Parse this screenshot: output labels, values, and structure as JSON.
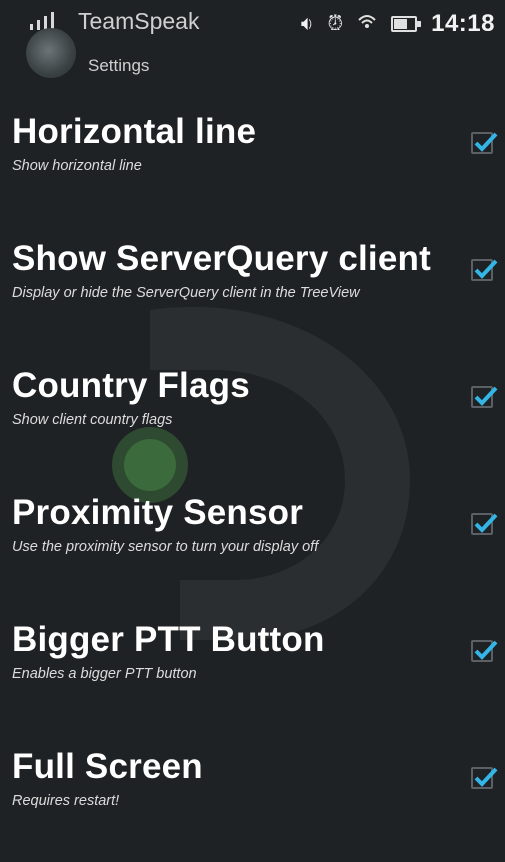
{
  "status_bar": {
    "app_title": "TeamSpeak",
    "time": "14:18",
    "icons": [
      "signal-icon",
      "sim-icon",
      "whatsapp-icon",
      "usb-icon",
      "volume-icon",
      "alarm-icon",
      "wifi-icon",
      "battery-icon"
    ]
  },
  "header": {
    "subtitle": "Settings"
  },
  "settings": [
    {
      "title": "Horizontal line",
      "summary": "Show horizontal line",
      "checked": true
    },
    {
      "title": "Show ServerQuery client",
      "summary": "Display or hide the ServerQuery client in the TreeView",
      "checked": true
    },
    {
      "title": "Country Flags",
      "summary": "Show client country flags",
      "checked": true
    },
    {
      "title": "Proximity Sensor",
      "summary": "Use the proximity sensor to turn your display off",
      "checked": true
    },
    {
      "title": "Bigger PTT Button",
      "summary": "Enables a bigger PTT button",
      "checked": true
    },
    {
      "title": "Full Screen",
      "summary": "Requires restart!",
      "checked": true
    }
  ],
  "colors": {
    "accent": "#33b5e5",
    "background": "#1f2224"
  }
}
